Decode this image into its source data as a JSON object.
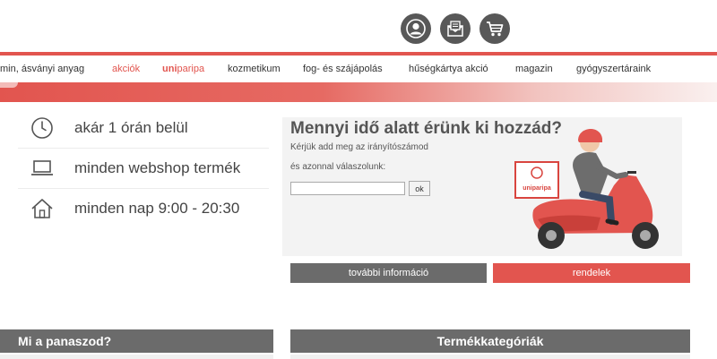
{
  "header": {
    "icons": [
      "user-icon",
      "newsletter-icon",
      "cart-icon"
    ],
    "accent_color": "#e2554f",
    "dark_color": "#585858"
  },
  "nav": {
    "items": [
      {
        "label": "min, ásványi anyag"
      },
      {
        "label": "akciók"
      },
      {
        "label_uni": "uni",
        "label_paripa": "paripa"
      },
      {
        "label": "kozmetikum"
      },
      {
        "label": "fog- és szájápolás"
      },
      {
        "label": "hűségkártya akció"
      },
      {
        "label": "magazin"
      },
      {
        "label": "gyógyszertáraink"
      }
    ]
  },
  "features": [
    {
      "icon": "clock-icon",
      "label": "akár 1 órán belül"
    },
    {
      "icon": "laptop-icon",
      "label": "minden webshop termék"
    },
    {
      "icon": "home-icon",
      "label": "minden nap 9:00 - 20:30"
    }
  ],
  "delivery": {
    "title": "Mennyi idő alatt érünk ki hozzád?",
    "line1": "Kérjük add meg az irányítószámod",
    "line2": "és azonnal válaszolunk:",
    "zip_value": "",
    "ok_label": "ok",
    "box_brand": "uniparipa"
  },
  "buttons": {
    "more_info": "további információ",
    "order": "rendelek"
  },
  "sections": {
    "complaint": "Mi a panaszod?",
    "categories": "Termékkategóriák"
  }
}
